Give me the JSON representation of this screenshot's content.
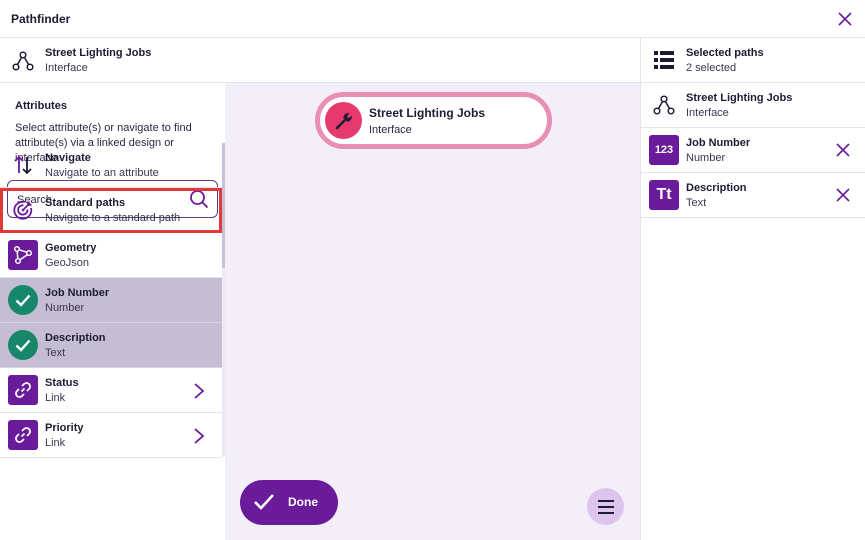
{
  "window": {
    "title": "Pathfinder"
  },
  "context": {
    "name": "Street Lighting Jobs",
    "type": "Interface",
    "icon": "hierarchy-icon"
  },
  "attributes": {
    "heading": "Attributes",
    "description": "Select attribute(s) or navigate to find attribute(s) via a linked design or interface",
    "search_placeholder": "Search"
  },
  "list": [
    {
      "title": "Navigate",
      "subtitle": "Navigate to an attribute",
      "icon": "swap-vertical-icon",
      "state": "normal"
    },
    {
      "title": "Standard paths",
      "subtitle": "Navigate to a standard path",
      "icon": "target-icon",
      "state": "highlighted"
    },
    {
      "title": "Geometry",
      "subtitle": "GeoJson",
      "icon": "geometry-icon",
      "state": "normal"
    },
    {
      "title": "Job Number",
      "subtitle": "Number",
      "icon": "check-circle-icon",
      "state": "selected"
    },
    {
      "title": "Description",
      "subtitle": "Text",
      "icon": "check-circle-icon",
      "state": "selected"
    },
    {
      "title": "Status",
      "subtitle": "Link",
      "icon": "link-icon",
      "state": "normal"
    },
    {
      "title": "Priority",
      "subtitle": "Link",
      "icon": "link-icon",
      "state": "normal"
    }
  ],
  "canvas": {
    "node": {
      "title": "Street Lighting Jobs",
      "subtitle": "Interface",
      "icon": "wrench-icon"
    },
    "done_label": "Done"
  },
  "selected": {
    "title": "Selected paths",
    "count_text": "2 selected",
    "root": {
      "title": "Street Lighting Jobs",
      "subtitle": "Interface"
    },
    "items": [
      {
        "title": "Job Number",
        "subtitle": "Number",
        "badge": "123"
      },
      {
        "title": "Description",
        "subtitle": "Text",
        "badge": "Tt"
      }
    ]
  },
  "colors": {
    "accent": "#6a1b9a",
    "selected_row": "#c4bdd3",
    "check_green": "#16876a",
    "node_pink": "#e63a6e",
    "node_border": "#ea8fb4",
    "highlight_red": "#e0393a",
    "canvas_bg": "#f3eff9"
  }
}
